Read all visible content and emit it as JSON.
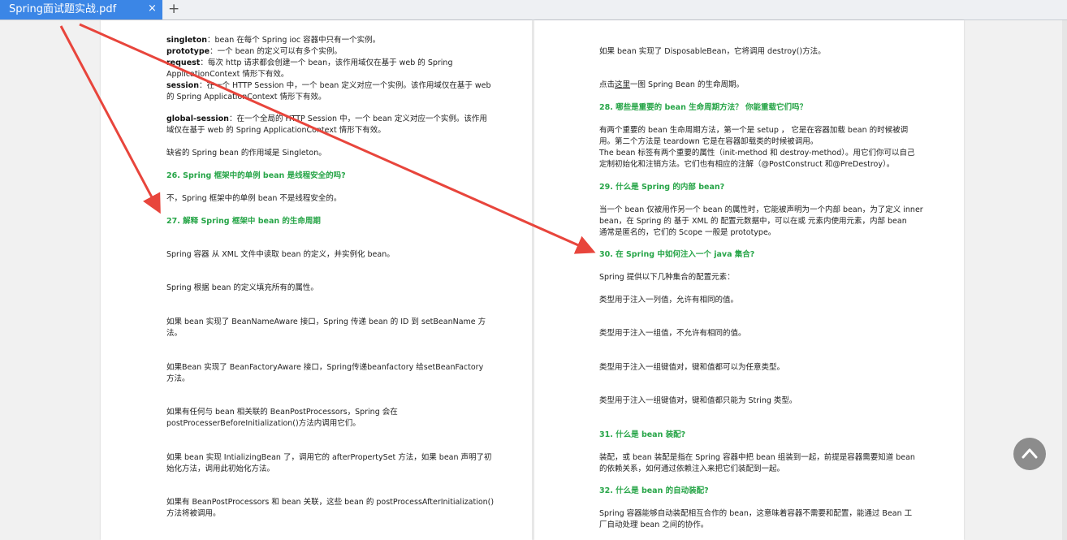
{
  "tabbar": {
    "tab_title": "Spring面试题实战.pdf",
    "close_glyph": "×",
    "add_glyph": "+"
  },
  "left_page": {
    "s1_a": "singleton",
    "s1_b": "：bean 在每个 Spring ioc  容器中只有一个实例。",
    "s2_a": "prototype",
    "s2_b": "：一个 bean 的定义可以有多个实例。",
    "s3_a": "request",
    "s3_b": "：每次 http 请求都会创建一个 bean，该作用域仅在基于 web 的 Spring",
    "s3_c": "ApplicationContext 情形下有效。",
    "s4_a": "session",
    "s4_b": "：在一个 HTTP Session 中，一个 bean 定义对应一个实例。该作用域仅在基于 web",
    "s4_c": "的 Spring ApplicationContext 情形下有效。",
    "s5_a": "global-session",
    "s5_b": "：在一个全局的 HTTP Session 中，一个 bean 定义对应一个实例。该作用",
    "s5_c": "域仅在基于 web 的 Spring ApplicationContext 情形下有效。",
    "default_scope": "缺省的 Spring bean  的作用域是 Singleton。",
    "q26": "26. Spring 框架中的单例 bean 是线程安全的吗?",
    "a26": "不，Spring 框架中的单例 bean 不是线程安全的。",
    "q27": "27. 解释 Spring 框架中 bean 的生命周期",
    "l1": "Spring 容器  从 XML  文件中读取 bean 的定义，并实例化 bean。",
    "l2": "Spring 根据 bean 的定义填充所有的属性。",
    "l3a": "如果 bean 实现了 BeanNameAware  接口，Spring  传递 bean  的 ID  到  setBeanName 方",
    "l3b": "法。",
    "l4a": "如果Bean  实现了  BeanFactoryAware  接口，Spring传递beanfactory  给setBeanFactory",
    "l4b": "方法。",
    "l5a": "如果有任何与 bean 相关联的 BeanPostProcessors，Spring 会在",
    "l5b": "postProcesserBeforeInitialization()方法内调用它们。",
    "l6a": "如果 bean 实现 IntializingBean 了，调用它的 afterPropertySet 方法，如果 bean 声明了初",
    "l6b": "始化方法，调用此初始化方法。",
    "l7a": "如果有 BeanPostProcessors  和 bean  关联，这些 bean 的 postProcessAfterInitialization()",
    "l7b": "方法将被调用。"
  },
  "right_page": {
    "r1": "如果 bean 实现了  DisposableBean，它将调用 destroy()方法。",
    "r2_a": "点击",
    "r2_link": "这里",
    "r2_b": "一图 Spring Bean 的生命周期。",
    "q28": "28.  哪些是重要的 bean 生命周期方法？  你能重载它们吗？",
    "a28_1": "有两个重要的 bean  生命周期方法，第一个是 setup  ，  它是在容器加载 bean 的时候被调",
    "a28_2": "用。第二个方法是   teardown   它是在容器卸载类的时候被调用。",
    "a28_3": "The bean  标签有两个重要的属性（init-method 和 destroy-method）。用它们你可以自己",
    "a28_4": "定制初始化和注销方法。它们也有相应的注解（@PostConstruct 和@PreDestroy）。",
    "q29": "29.  什么是 Spring 的内部 bean?",
    "a29_1": "当一个 bean 仅被用作另一个 bean 的属性时，它能被声明为一个内部 bean，为了定义 inner",
    "a29_2": "bean，在 Spring  的  基于 XML  的  配置元数据中，可以在或  元素内使用元素，内部 bean",
    "a29_3": "通常是匿名的，它们的 Scope 一般是 prototype。",
    "q30": "30.  在  Spring 中如何注入一个 java 集合?",
    "a30_0": "Spring 提供以下几种集合的配置元素：",
    "a30_1": "类型用于注入一列值，允许有相同的值。",
    "a30_2": "类型用于注入一组值，不允许有相同的值。",
    "a30_3": "类型用于注入一组键值对，键和值都可以为任意类型。",
    "a30_4": "类型用于注入一组键值对，键和值都只能为 String 类型。",
    "q31": "31.  什么是 bean 装配?",
    "a31_1": "装配，或 bean  装配是指在 Spring  容器中把 bean 组装到一起，前提是容器需要知道 bean",
    "a31_2": "的依赖关系，如何通过依赖注入来把它们装配到一起。",
    "q32": "32.  什么是 bean 的自动装配?",
    "a32_1": "Spring  容器能够自动装配相互合作的 bean，这意味着容器不需要和配置，能通过 Bean 工",
    "a32_2": "厂自动处理 bean 之间的协作。"
  },
  "colors": {
    "tab_active": "#3b86e6",
    "heading_green": "#27a548",
    "annotation_red": "#e8453c",
    "scroll_top_button": "#8c8c8c"
  },
  "icons": {
    "scroll_top": "chevron-up-icon",
    "annotation": "arrow-icon"
  }
}
